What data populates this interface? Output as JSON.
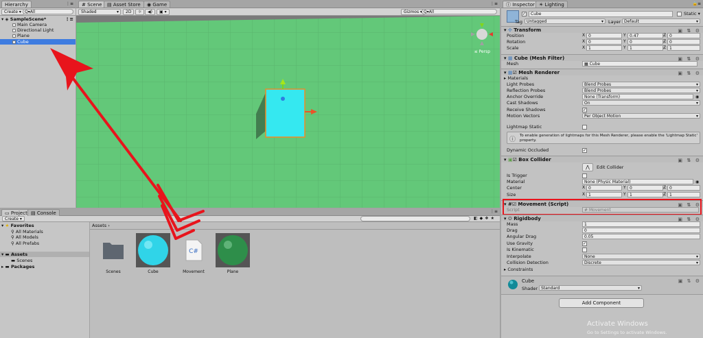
{
  "hierarchy": {
    "tab": "Hierarchy",
    "create": "Create",
    "search_placeholder": "Q▾All",
    "scene": "SampleScene*",
    "items": [
      "Main Camera",
      "Directional Light",
      "Plane",
      "Cube"
    ]
  },
  "scene_view": {
    "tabs": [
      "Scene",
      "Asset Store",
      "Game"
    ],
    "shading": "Shaded",
    "mode_2d": "2D",
    "gizmos": "Gizmos",
    "search_placeholder": "Q▾All",
    "persp": "Persp"
  },
  "project": {
    "tabs": [
      "Project",
      "Console"
    ],
    "create": "Create",
    "favorites_label": "Favorites",
    "favorites": [
      "All Materials",
      "All Models",
      "All Prefabs"
    ],
    "assets_label": "Assets",
    "assets_children": [
      "Scenes"
    ],
    "packages_label": "Packages",
    "breadcrumb": "Assets",
    "assets": [
      {
        "name": "Scenes",
        "kind": "folder"
      },
      {
        "name": "Cube",
        "kind": "material-cyan"
      },
      {
        "name": "Movement",
        "kind": "script"
      },
      {
        "name": "Plane",
        "kind": "material-green"
      }
    ],
    "script_glyph": "C#"
  },
  "inspector": {
    "tabs": [
      "Inspector",
      "Lighting"
    ],
    "object_name": "Cube",
    "static_label": "Static",
    "tag_label": "Tag",
    "tag_value": "Untagged",
    "layer_label": "Layer",
    "layer_value": "Default",
    "transform": {
      "title": "Transform",
      "position_label": "Position",
      "position": [
        "0",
        "0.47",
        "0"
      ],
      "rotation_label": "Rotation",
      "rotation": [
        "0",
        "0",
        "0"
      ],
      "scale_label": "Scale",
      "scale": [
        "1",
        "1",
        "1"
      ]
    },
    "mesh_filter": {
      "title": "Cube (Mesh Filter)",
      "mesh_label": "Mesh",
      "mesh_value": "Cube"
    },
    "mesh_renderer": {
      "title": "Mesh Renderer",
      "materials": "Materials",
      "light_probes_label": "Light Probes",
      "light_probes": "Blend Probes",
      "reflection_probes_label": "Reflection Probes",
      "reflection_probes": "Blend Probes",
      "anchor_override_label": "Anchor Override",
      "anchor_override": "None (Transform)",
      "cast_shadows_label": "Cast Shadows",
      "cast_shadows": "On",
      "receive_shadows_label": "Receive Shadows",
      "motion_vectors_label": "Motion Vectors",
      "motion_vectors": "Per Object Motion",
      "lightmap_static_label": "Lightmap Static",
      "info": "To enable generation of lightmaps for this Mesh Renderer, please enable the 'Lightmap Static' property.",
      "dynamic_occluded_label": "Dynamic Occluded"
    },
    "box_collider": {
      "title": "Box Collider",
      "edit_collider": "Edit Collider",
      "is_trigger_label": "Is Trigger",
      "material_label": "Material",
      "material_value": "None (Physic Material)",
      "center_label": "Center",
      "center": [
        "0",
        "0",
        "0"
      ],
      "size_label": "Size",
      "size": [
        "1",
        "1",
        "1"
      ]
    },
    "movement": {
      "title": "Movement (Script)",
      "script_label": "Script",
      "script_value": "Movement"
    },
    "rigidbody": {
      "title": "Rigidbody",
      "mass_label": "Mass",
      "mass": "1",
      "drag_label": "Drag",
      "drag": "0",
      "angular_drag_label": "Angular Drag",
      "angular_drag": "0.05",
      "use_gravity_label": "Use Gravity",
      "is_kinematic_label": "Is Kinematic",
      "interpolate_label": "Interpolate",
      "interpolate": "None",
      "collision_label": "Collision Detection",
      "collision": "Discrete",
      "constraints_label": "Constraints"
    },
    "material": {
      "name": "Cube",
      "shader_label": "Shader",
      "shader_value": "Standard"
    },
    "add_component": "Add Component"
  },
  "watermark": {
    "title": "Activate Windows",
    "subtitle": "Go to Settings to activate Windows."
  },
  "axis_labels": {
    "x": "X",
    "y": "Y",
    "z": "Z"
  },
  "colors": {
    "scene_green": "#63c879",
    "cube_cyan": "#35e8f0",
    "selection_blue": "#3e7ce0",
    "arrow_red": "#e8141c",
    "highlight_red": "#e8141c"
  }
}
